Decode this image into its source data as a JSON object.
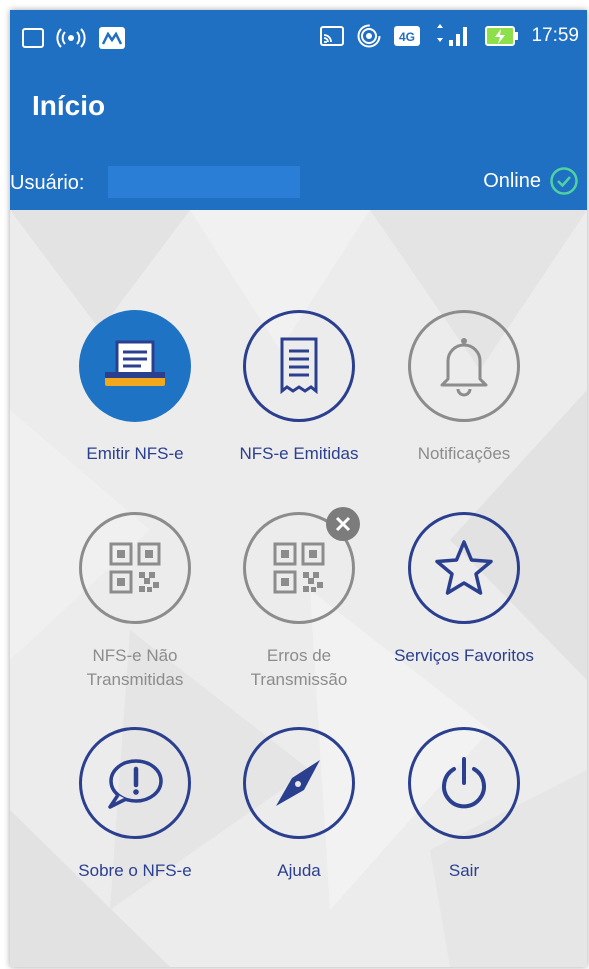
{
  "status_bar": {
    "time": "17:59",
    "network": "4G",
    "icons": [
      "image-icon",
      "broadcast-icon",
      "app-icon",
      "cast-icon",
      "hotspot-icon",
      "signal-icon",
      "battery-charging-icon"
    ]
  },
  "header": {
    "title": "Início"
  },
  "user_bar": {
    "label": "Usuário:",
    "status": "Online"
  },
  "menu": [
    {
      "label": "Emitir NFS-e",
      "icon": "printer-receipt-icon",
      "style": "filled"
    },
    {
      "label": "NFS-e Emitidas",
      "icon": "receipt-icon",
      "style": "blue"
    },
    {
      "label": "Notificações",
      "icon": "bell-icon",
      "style": "gray"
    },
    {
      "label": "NFS-e Não Transmitidas",
      "icon": "qr-code-icon",
      "style": "gray"
    },
    {
      "label": "Erros de Transmissão",
      "icon": "qr-code-icon",
      "style": "gray",
      "badge": "close-badge-icon"
    },
    {
      "label": "Serviços Favoritos",
      "icon": "star-icon",
      "style": "blue"
    },
    {
      "label": "Sobre o NFS-e",
      "icon": "speech-exclamation-icon",
      "style": "blue"
    },
    {
      "label": "Ajuda",
      "icon": "compass-icon",
      "style": "blue"
    },
    {
      "label": "Sair",
      "icon": "power-icon",
      "style": "blue"
    }
  ],
  "colors": {
    "primary": "#1f6fc2",
    "accent_dark": "#2b3f8f",
    "inactive": "#8c8c8c",
    "online_check": "#4cd3a0"
  }
}
